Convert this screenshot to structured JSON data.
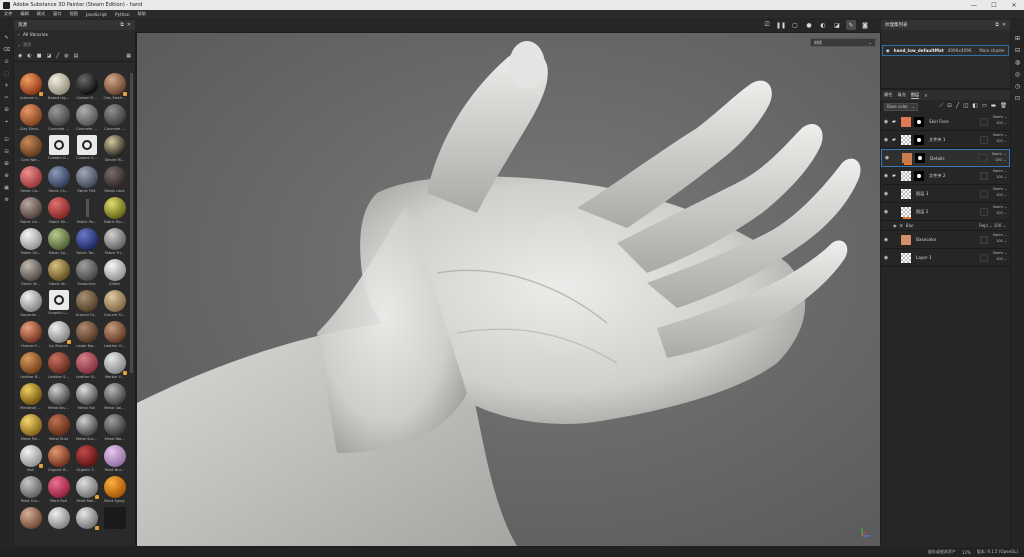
{
  "window": {
    "title": "Adobe Substance 3D Painter (Steam Edition) - hand",
    "controls": [
      "—",
      "☐",
      "✕"
    ]
  },
  "menubar": [
    "文件",
    "编辑",
    "模式",
    "窗口",
    "视图",
    "JavaScript",
    "Python",
    "帮助"
  ],
  "viewport_toolbar": {
    "icons": [
      "camera-icon",
      "pause-icon",
      "screen-icon",
      "sphere-icon",
      "paint-icon",
      "light-icon",
      "brush-icon",
      "capture-icon"
    ],
    "glyphs": [
      "⎚",
      "❚❚",
      "▢",
      "●",
      "◐",
      "◪",
      "✎",
      "◙"
    ]
  },
  "left_tools": [
    "✎",
    "⌫",
    "⊙",
    "⬚",
    "⚘",
    "✂",
    "⊞",
    "⌖",
    "⊡",
    "⊟",
    "⊠",
    "⊕",
    "▣",
    "⊗"
  ],
  "assets": {
    "title": "资源",
    "path": "All libraries",
    "search_placeholder": "搜索",
    "filters": [
      "◉",
      "◐",
      "■",
      "◪",
      "╱",
      "◍",
      "▤"
    ],
    "grid_icon": "▦",
    "items": [
      {
        "label": "Autumn L...",
        "c1": "#f0a060",
        "c2": "#8a2d12",
        "badge": true
      },
      {
        "label": "Baked Lig...",
        "c1": "#f4eee0",
        "c2": "#8d8778",
        "badge": false
      },
      {
        "label": "Carbon Fi...",
        "c1": "#6a6a6a",
        "c2": "#050505",
        "badge": false
      },
      {
        "label": "Clay Earth...",
        "c1": "#d4a888",
        "c2": "#5e3a26",
        "badge": true
      },
      {
        "label": "Clay Simp...",
        "c1": "#e89a68",
        "c2": "#7a3a18",
        "badge": false
      },
      {
        "label": "Concrete ...",
        "c1": "#9a9a9a",
        "c2": "#3c3c3c",
        "badge": false
      },
      {
        "label": "Concrete ...",
        "c1": "#b0b0b0",
        "c2": "#4c4c4c",
        "badge": false
      },
      {
        "label": "Concrete ...",
        "c1": "#909090",
        "c2": "#353535",
        "badge": false
      },
      {
        "label": "Cork Nat...",
        "c1": "#c88a5a",
        "c2": "#5a3418",
        "badge": false
      },
      {
        "label": "Custom G...",
        "c1": "#eeeeee",
        "c2": "#555555",
        "badge": false,
        "special": "gradient"
      },
      {
        "label": "Custom S...",
        "c1": "#eeeeee",
        "c2": "#555555",
        "badge": false,
        "special": "settings"
      },
      {
        "label": "Denim Ri...",
        "c1": "#d8c8a0",
        "c2": "#151515",
        "badge": false
      },
      {
        "label": "Fabric Ca...",
        "c1": "#f09090",
        "c2": "#903030",
        "badge": false
      },
      {
        "label": "Fabric Ch...",
        "c1": "#8a9ab8",
        "c2": "#2a3450",
        "badge": false
      },
      {
        "label": "Fabric Felt",
        "c1": "#a0a8b8",
        "c2": "#3a4050",
        "badge": false
      },
      {
        "label": "Fabric Lace",
        "c1": "#7a6a6a",
        "c2": "#2a2222",
        "badge": false
      },
      {
        "label": "Fabric Lin...",
        "c1": "#b8a8a0",
        "c2": "#4a3a34",
        "badge": false
      },
      {
        "label": "Fabric Ml...",
        "c1": "#e07070",
        "c2": "#802020",
        "badge": false
      },
      {
        "label": "Fabric Po...",
        "c1": "#444444",
        "c2": "#222222",
        "badge": false,
        "special": "strip"
      },
      {
        "label": "Fabric Rip...",
        "c1": "#e0e070",
        "c2": "#5a5a10",
        "badge": false
      },
      {
        "label": "Fabric Sil...",
        "c1": "#f6f6f6",
        "c2": "#8a8a8a",
        "badge": false
      },
      {
        "label": "Fabric Sp...",
        "c1": "#b8c890",
        "c2": "#465a2a",
        "badge": false
      },
      {
        "label": "Fabric Tar...",
        "c1": "#6a7ac8",
        "c2": "#1a2260",
        "badge": false
      },
      {
        "label": "Fabric Tri...",
        "c1": "#d0d0d0",
        "c2": "#5a5a5a",
        "badge": false
      },
      {
        "label": "Fabric W...",
        "c1": "#c0b8b0",
        "c2": "#4a4440",
        "badge": false
      },
      {
        "label": "Fabric W...",
        "c1": "#d8c080",
        "c2": "#5a4818",
        "badge": false
      },
      {
        "label": "Footprints",
        "c1": "#a0a0a0",
        "c2": "#404040",
        "badge": false
      },
      {
        "label": "Glitter",
        "c1": "#f8f8f8",
        "c2": "#8a8a8a",
        "badge": false
      },
      {
        "label": "Gouache ...",
        "c1": "#f0f0f0",
        "c2": "#7a7a7a",
        "badge": false
      },
      {
        "label": "Graphic L...",
        "c1": "#eeeeee",
        "c2": "#555555",
        "badge": false,
        "special": "graphic"
      },
      {
        "label": "Ground Gr...",
        "c1": "#a89070",
        "c2": "#4a3a22",
        "badge": false
      },
      {
        "label": "Ground Sl...",
        "c1": "#e0c8a0",
        "c2": "#7a6040",
        "badge": false
      },
      {
        "label": "Human F...",
        "c1": "#e8a080",
        "c2": "#6a2a18",
        "badge": false
      },
      {
        "label": "Ivy Branch",
        "c1": "#f0f0f0",
        "c2": "#7a7a7a",
        "badge": true
      },
      {
        "label": "Large Kar...",
        "c1": "#b08a70",
        "c2": "#4a3020",
        "badge": false
      },
      {
        "label": "Leather G...",
        "c1": "#c89a7a",
        "c2": "#5a3220",
        "badge": false
      },
      {
        "label": "Leather B...",
        "c1": "#d89a60",
        "c2": "#6a3810",
        "badge": false
      },
      {
        "label": "Leather S...",
        "c1": "#c87060",
        "c2": "#5a2418",
        "badge": false
      },
      {
        "label": "Leather Sl...",
        "c1": "#d8808a",
        "c2": "#7a2a38",
        "badge": false
      },
      {
        "label": "Marble V...",
        "c1": "#e8e8e8",
        "c2": "#808080",
        "badge": true
      },
      {
        "label": "Medieval ...",
        "c1": "#f0d060",
        "c2": "#6a4a08",
        "badge": false
      },
      {
        "label": "Metal Bru...",
        "c1": "#d0d0d0",
        "c2": "#3a3a3a",
        "badge": false
      },
      {
        "label": "Metal Foil",
        "c1": "#e0e0e0",
        "c2": "#404040",
        "badge": false
      },
      {
        "label": "Metal Gal...",
        "c1": "#b8b8b8",
        "c2": "#383838",
        "badge": false
      },
      {
        "label": "Metal Pol...",
        "c1": "#f8d870",
        "c2": "#7a5a10",
        "badge": false
      },
      {
        "label": "Metal Rust",
        "c1": "#c07050",
        "c2": "#5a2814",
        "badge": false
      },
      {
        "label": "Metal Sca...",
        "c1": "#d0d0d0",
        "c2": "#3a3a3a",
        "badge": false
      },
      {
        "label": "Metal Wo...",
        "c1": "#a0a0a0",
        "c2": "#303030",
        "badge": false
      },
      {
        "label": "Nail",
        "c1": "#f4f4f4",
        "c2": "#8a8a8a",
        "badge": true
      },
      {
        "label": "Organic B...",
        "c1": "#e09870",
        "c2": "#6a2a18",
        "badge": false
      },
      {
        "label": "Organic T...",
        "c1": "#c04848",
        "c2": "#5a1010",
        "badge": false
      },
      {
        "label": "Paint Bru...",
        "c1": "#e8c8f0",
        "c2": "#8a6a9a",
        "badge": false
      },
      {
        "label": "Paint Cra...",
        "c1": "#c8c8c8",
        "c2": "#5a5a5a",
        "badge": false
      },
      {
        "label": "Paint Roll",
        "c1": "#f07090",
        "c2": "#8a1a38",
        "badge": false
      },
      {
        "label": "Paint Roll...",
        "c1": "#e0e0e0",
        "c2": "#6a6a6a",
        "badge": true
      },
      {
        "label": "Paint Spray",
        "c1": "#ffb040",
        "c2": "#a05000",
        "badge": false
      },
      {
        "label": "",
        "c1": "#d8b098",
        "c2": "#6a4030",
        "badge": false
      },
      {
        "label": "",
        "c1": "#f0f0f0",
        "c2": "#7a7a7a",
        "badge": false
      },
      {
        "label": "",
        "c1": "#e8e8e8",
        "c2": "#6a6a6a",
        "badge": true
      },
      {
        "label": "",
        "c1": "#222222",
        "c2": "#111111",
        "badge": false,
        "special": "small"
      }
    ],
    "footer_left": [
      "▤",
      "⊞"
    ],
    "footer_right": [
      "◯",
      "⊡",
      "✚"
    ]
  },
  "viewport": {
    "dropdown_value": "材质",
    "dropdown_chevron": "⌄"
  },
  "texture_set": {
    "title": "纹理集列表",
    "row": {
      "name": "hand_low_defaultMat",
      "resolution": "4096x4096",
      "shader": "Main shader"
    }
  },
  "layers": {
    "tabs": [
      "属性",
      "填充",
      "图层"
    ],
    "active_tab_index": 2,
    "blend_mode": "Base color",
    "tool_icons": [
      "⟋",
      "⊡",
      "╱",
      "◫",
      "◧",
      "▭",
      "▬",
      "🗑"
    ],
    "items": [
      {
        "name": "Skin Face",
        "type": "folder",
        "thumb": "#e07a54",
        "has_mask": true,
        "blend": "Norm",
        "opacity": "100"
      },
      {
        "name": "文件夹 1",
        "type": "folder",
        "thumb": "checker",
        "has_mask": true,
        "blend": "Norm",
        "opacity": "100"
      },
      {
        "name": "Details",
        "type": "layer",
        "thumb": "#c87a50",
        "has_mask": true,
        "blend": "Norm",
        "opacity": "100",
        "selected": true,
        "orange": true
      },
      {
        "name": "文件夹 2",
        "type": "folder",
        "thumb": "checker",
        "has_mask": true,
        "blend": "Norm",
        "opacity": "100"
      },
      {
        "name": "图层 3",
        "type": "layer",
        "thumb": "checker",
        "has_mask": false,
        "blend": "Norm",
        "opacity": "100"
      },
      {
        "name": "图层 2",
        "type": "layer",
        "thumb": "checker",
        "has_mask": false,
        "blend": "Norm",
        "opacity": "100",
        "orange": true
      }
    ],
    "sublayer": {
      "name": "Blur",
      "blend": "Repl",
      "opacity": "100"
    },
    "items_after": [
      {
        "name": "Basecolor",
        "type": "layer",
        "thumb": "#d4906a",
        "has_mask": false,
        "blend": "Norm",
        "opacity": "100"
      },
      {
        "name": "Layer 1",
        "type": "layer",
        "thumb": "checker",
        "has_mask": false,
        "blend": "Norm",
        "opacity": "100"
      }
    ]
  },
  "right_icons": [
    "⊞",
    "⊟",
    "◍",
    "◎",
    "◷",
    "⊡"
  ],
  "statusbar": {
    "message": "留存或放弃资产",
    "zoom": "12%",
    "version": "版本: 9.1.5 (OpenGL)"
  }
}
